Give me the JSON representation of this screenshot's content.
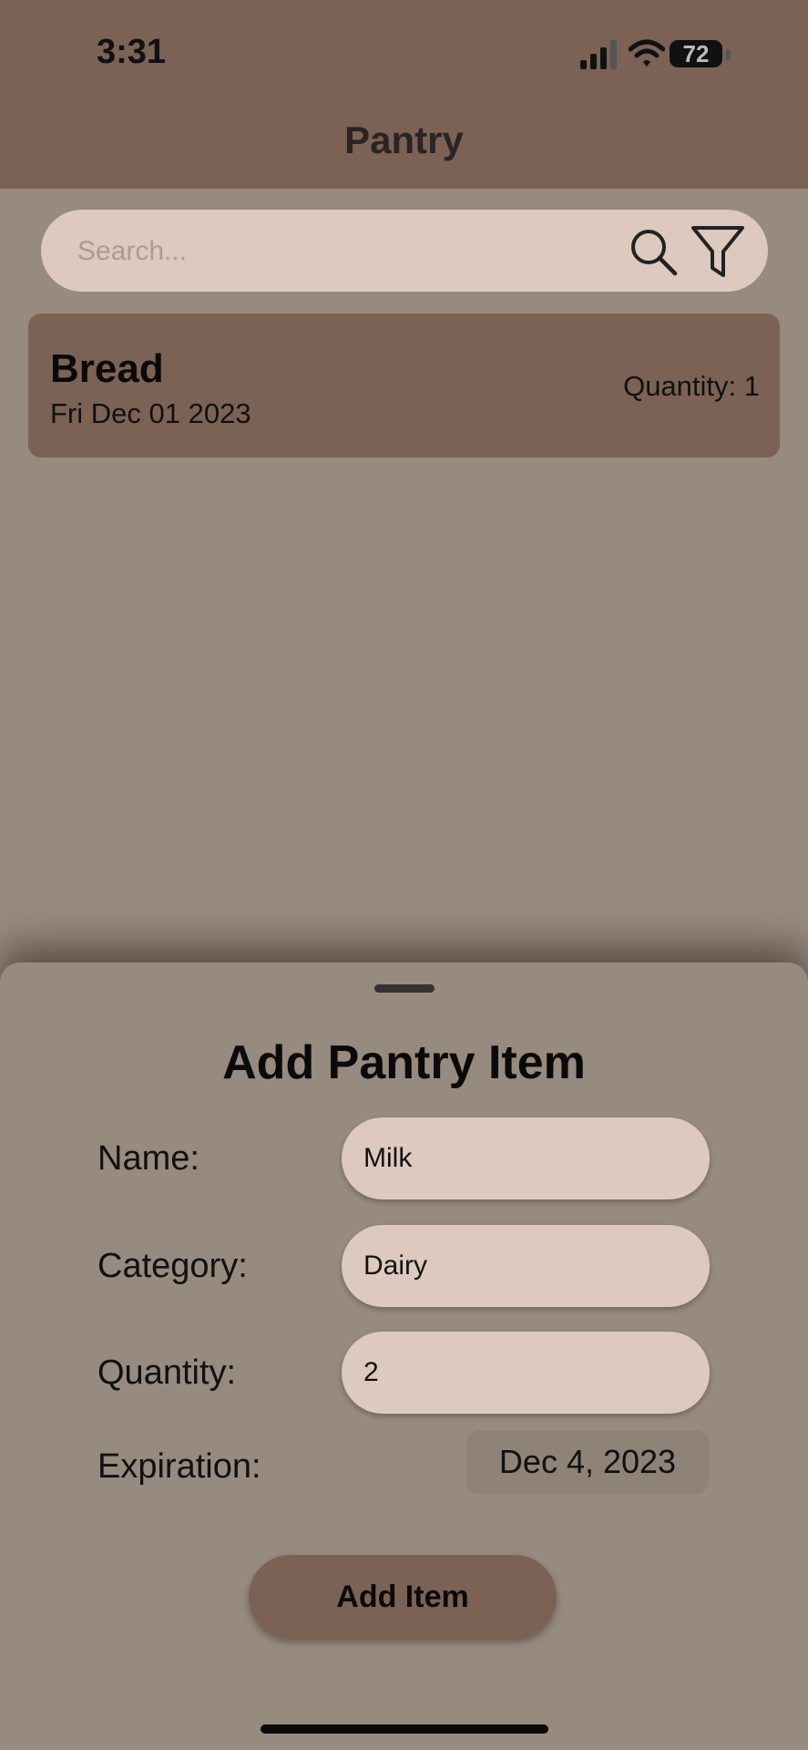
{
  "status_bar": {
    "time": "3:31",
    "battery": "72"
  },
  "header": {
    "title": "Pantry"
  },
  "search": {
    "placeholder": "Search..."
  },
  "items": [
    {
      "name": "Bread",
      "date": "Fri Dec 01 2023",
      "quantity": "Quantity: 1"
    }
  ],
  "sheet": {
    "title": "Add Pantry Item",
    "name_label": "Name:",
    "name_value": "Milk",
    "category_label": "Category:",
    "category_value": "Dairy",
    "quantity_label": "Quantity:",
    "quantity_value": "2",
    "expiration_label": "Expiration:",
    "expiration_value": "Dec 4, 2023",
    "add_button": "Add Item"
  },
  "icons": [
    "signal-icon",
    "wifi-icon",
    "battery-icon",
    "search-icon",
    "filter-icon"
  ],
  "colors": {
    "header": "#7b6255",
    "background": "#978a7e",
    "field": "#ddc9bd"
  }
}
